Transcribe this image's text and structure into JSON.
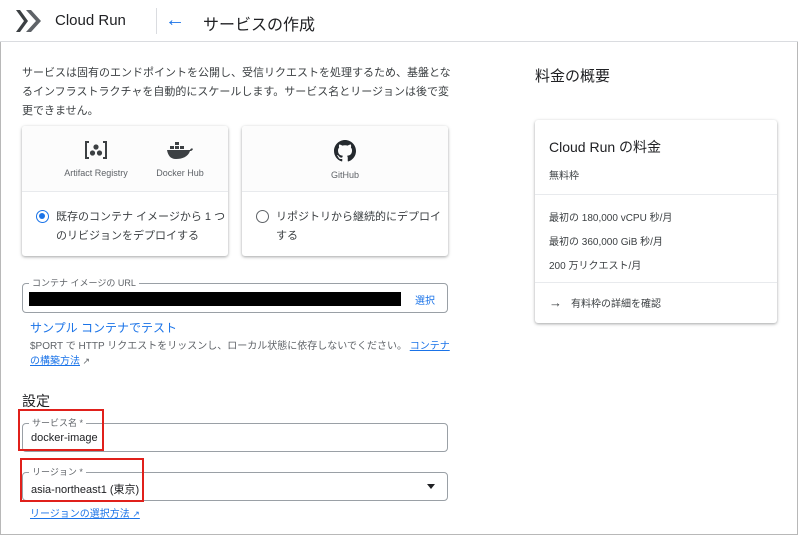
{
  "header": {
    "app_name": "Cloud Run",
    "page_title": "サービスの作成",
    "icons": {
      "logo": "cloud-run-logo",
      "back": "arrow-left-icon"
    }
  },
  "intro": "サービスは固有のエンドポイントを公開し、受信リクエストを処理するため、基盤となるインフラストラクチャを自動的にスケールします。サービス名とリージョンは後で変更できません。",
  "source_options": [
    {
      "sources": [
        "Artifact Registry",
        "Docker Hub"
      ],
      "label": "既存のコンテナ イメージから 1 つのリビジョンをデプロイする",
      "selected": true
    },
    {
      "sources": [
        "GitHub"
      ],
      "label": "リポジトリから継続的にデプロイする",
      "selected": false
    }
  ],
  "container_url": {
    "label": "コンテナ イメージの URL",
    "value": "",
    "select_label": "選択"
  },
  "sample_link": "サンプル コンテナでテスト",
  "helper": {
    "text": "$PORT で HTTP リクエストをリッスンし、ローカル状態に依存しないでください。",
    "link": "コンテナの構築方法"
  },
  "settings": {
    "title": "設定",
    "service_name_label": "サービス名 *",
    "service_name_value": "docker-image",
    "region_label": "リージョン *",
    "region_value": "asia-northeast1 (東京)",
    "region_link": "リージョンの選択方法"
  },
  "pricing": {
    "title": "料金の概要",
    "card_title": "Cloud Run の料金",
    "free_tier": "無料枠",
    "lines": [
      "最初の 180,000 vCPU 秒/月",
      "最初の 360,000 GiB 秒/月",
      "200 万リクエスト/月"
    ],
    "details_link": "有料枠の詳細を確認"
  },
  "colors": {
    "accent": "#1a73e8",
    "highlight": "#e0201b"
  }
}
